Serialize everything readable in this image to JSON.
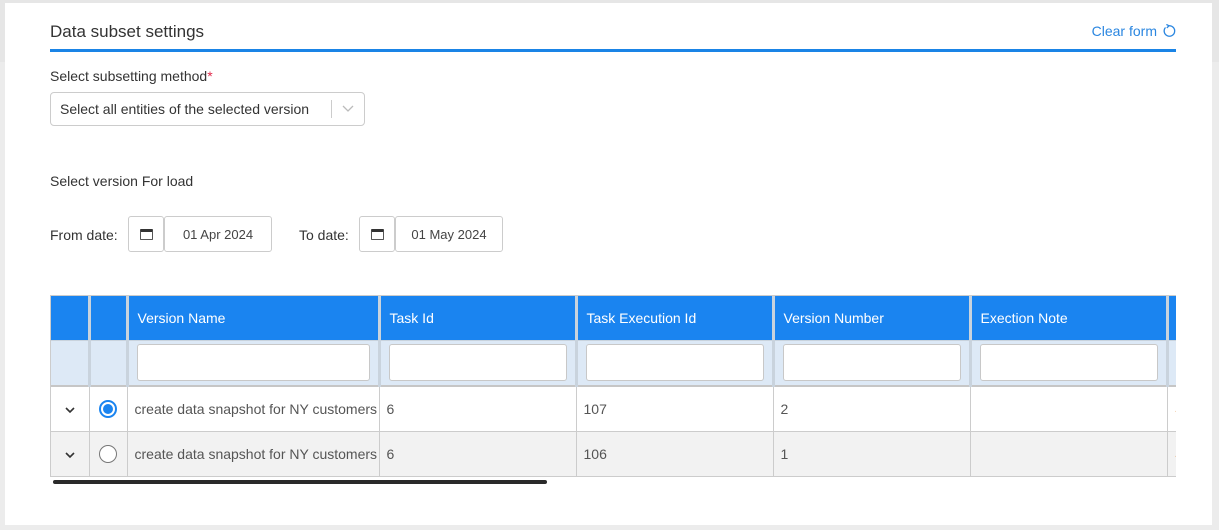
{
  "header": {
    "title": "Data subset settings",
    "clear_form_label": "Clear form",
    "clear_form_icon": "refresh-icon"
  },
  "subsetting": {
    "label": "Select subsetting method",
    "required_mark": "*",
    "selected": "Select all entities of the selected version"
  },
  "version_section": {
    "label": "Select version For load",
    "from_label": "From date:",
    "from_value": "01 Apr 2024",
    "to_label": "To date:",
    "to_value": "01 May 2024",
    "calendar_icon": "calendar-icon"
  },
  "colors": {
    "accent": "#1a84e6",
    "header_bg": "#1a84f0",
    "filter_bg": "#dde9f6"
  },
  "table": {
    "columns": [
      "",
      "",
      "Version Name",
      "Task Id",
      "Task Execution Id",
      "Version Number",
      "Exection Note",
      ""
    ],
    "rows": [
      {
        "selected": true,
        "version_name": "create data snapshot for NY customers",
        "task_id": "6",
        "task_execution_id": "107",
        "version_number": "2",
        "execution_note": ""
      },
      {
        "selected": false,
        "version_name": "create data snapshot for NY customers",
        "task_id": "6",
        "task_execution_id": "106",
        "version_number": "1",
        "execution_note": ""
      }
    ]
  }
}
